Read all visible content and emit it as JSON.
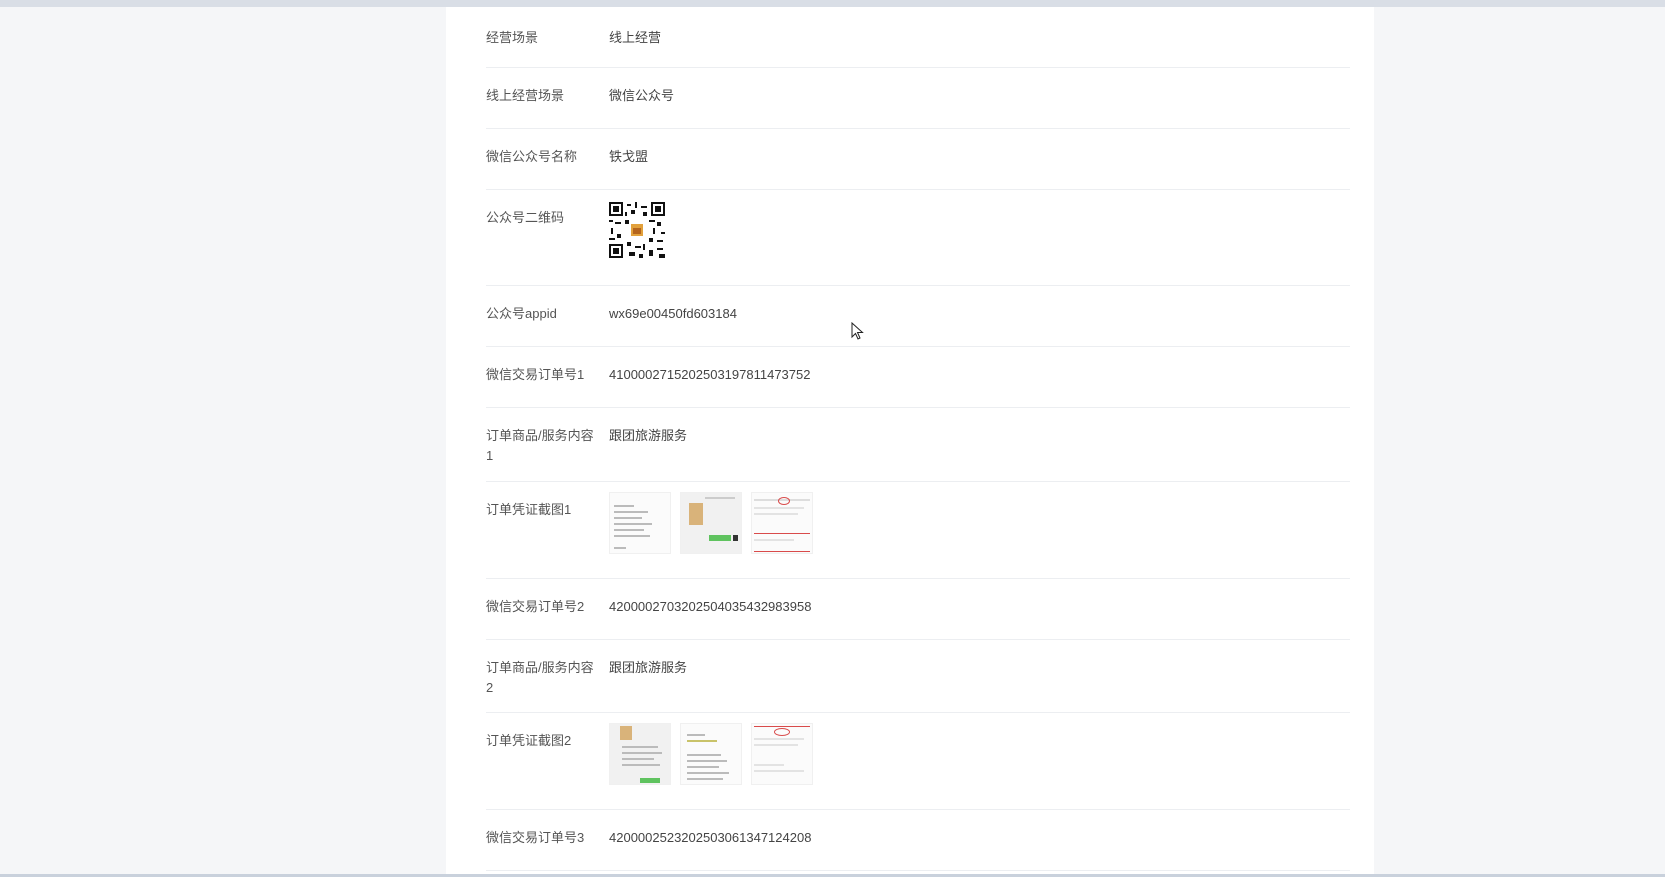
{
  "details": [
    {
      "label": "经营场景",
      "value": "线上经营"
    },
    {
      "label": "线上经营场景",
      "value": "微信公众号"
    },
    {
      "label": "微信公众号名称",
      "value": "铁戈盟"
    },
    {
      "label": "公众号二维码",
      "value": ""
    },
    {
      "label": "公众号appid",
      "value": "wx69e00450fd603184"
    },
    {
      "label": "微信交易订单号1",
      "value": "4100002715202503197811473752"
    },
    {
      "label": "订单商品/服务内容1",
      "value": "跟团旅游服务"
    },
    {
      "label": "订单凭证截图1",
      "value": ""
    },
    {
      "label": "微信交易订单号2",
      "value": "4200002703202504035432983958"
    },
    {
      "label": "订单商品/服务内容2",
      "value": "跟团旅游服务"
    },
    {
      "label": "订单凭证截图2",
      "value": ""
    },
    {
      "label": "微信交易订单号3",
      "value": "4200002523202503061347124208"
    }
  ]
}
